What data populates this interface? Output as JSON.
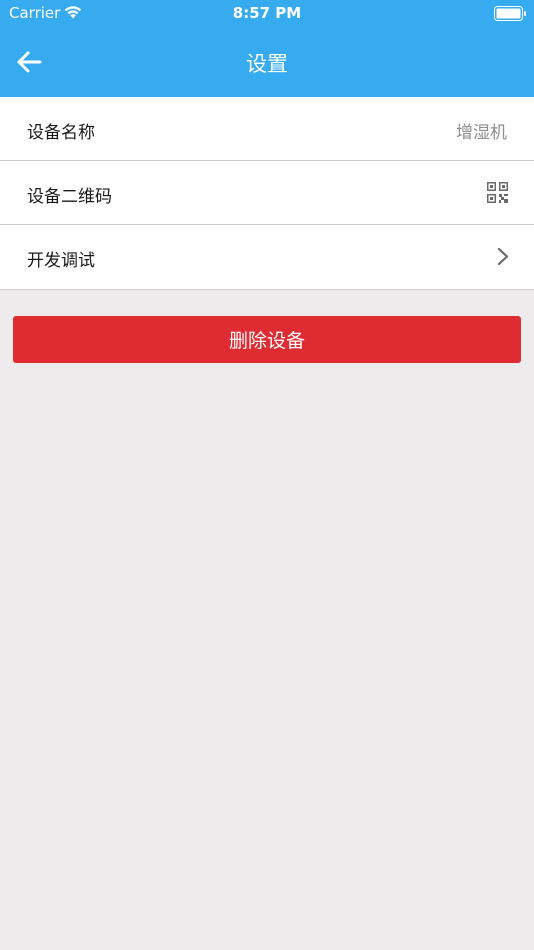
{
  "status_bar": {
    "carrier": "Carrier",
    "time": "8:57 PM",
    "wifi_icon": "wifi-icon",
    "battery_icon": "battery-full-icon"
  },
  "nav": {
    "title": "设置",
    "back_icon": "arrow-left-icon"
  },
  "settings": {
    "items": [
      {
        "label": "设备名称",
        "value": "增湿机",
        "accessory": "text"
      },
      {
        "label": "设备二维码",
        "accessory": "qr-code-icon"
      },
      {
        "label": "开发调试",
        "accessory": "chevron-right-icon"
      }
    ]
  },
  "actions": {
    "delete_label": "删除设备"
  },
  "colors": {
    "header": "#37abf0",
    "background": "#edebeb",
    "danger": "#df2c32"
  }
}
